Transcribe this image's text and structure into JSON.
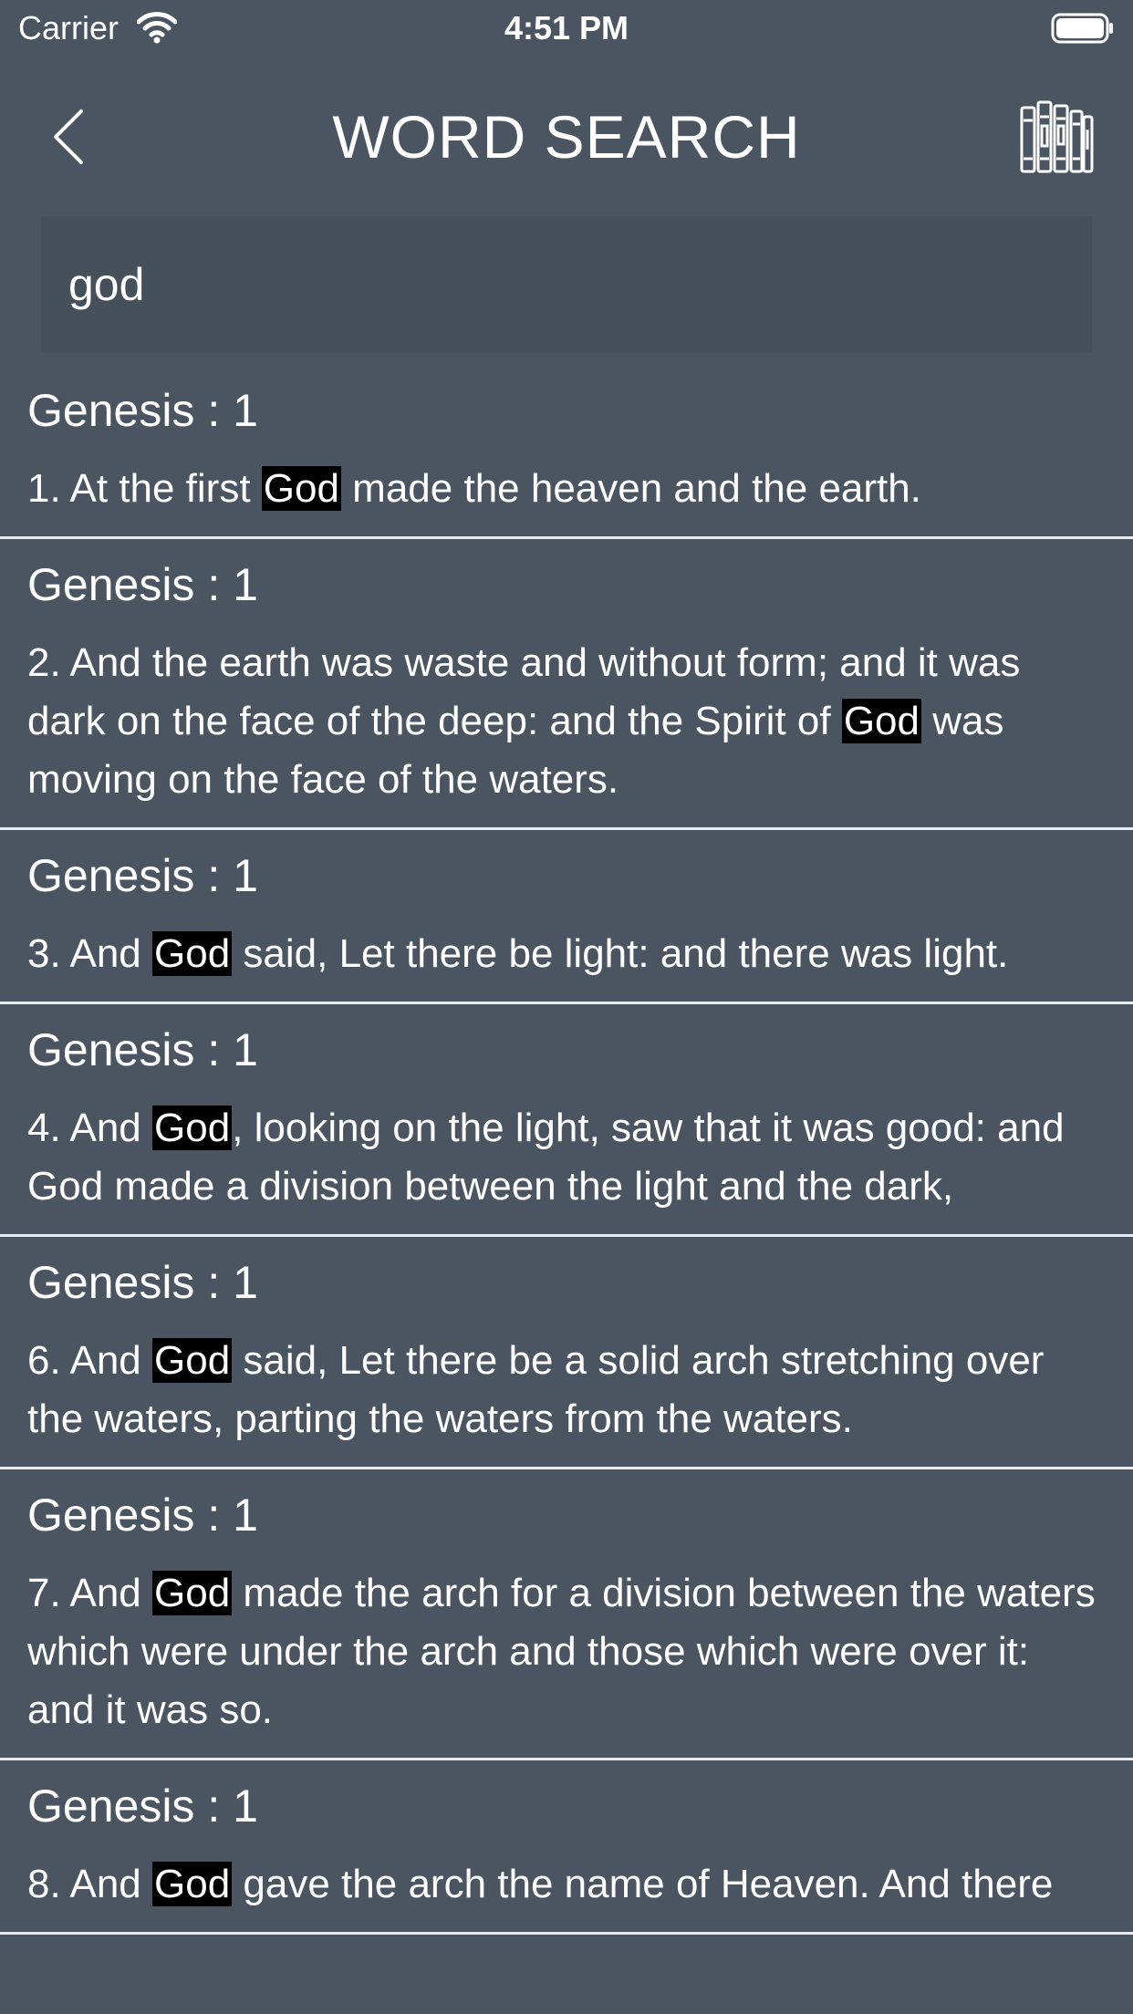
{
  "status_bar": {
    "carrier": "Carrier",
    "time": "4:51 PM"
  },
  "header": {
    "title": "WORD SEARCH",
    "back_icon": "chevron-left-icon",
    "library_icon": "bookshelf-icon"
  },
  "search": {
    "value": "god",
    "placeholder": ""
  },
  "colors": {
    "background": "#4b5561",
    "search_field": "#46505b",
    "highlight": "#000000",
    "text": "#ffffff",
    "divider": "#e8ebee"
  },
  "results": [
    {
      "reference": "Genesis : 1",
      "before": "1. At the first ",
      "match": "God",
      "after": " made the heaven and the earth."
    },
    {
      "reference": "Genesis : 1",
      "before": "2. And the earth was waste and without form; and it was dark on the face of the deep: and the Spirit of ",
      "match": "God",
      "after": " was moving on the face of the waters."
    },
    {
      "reference": "Genesis : 1",
      "before": "3. And ",
      "match": "God",
      "after": " said, Let there be light: and there was light."
    },
    {
      "reference": "Genesis : 1",
      "before": "4. And ",
      "match": "God",
      "after": ", looking on the light, saw that it was good: and God made a division between the light and the dark,"
    },
    {
      "reference": "Genesis : 1",
      "before": "6. And ",
      "match": "God",
      "after": " said, Let there be a solid arch stretching over the waters, parting the waters from the waters."
    },
    {
      "reference": "Genesis : 1",
      "before": "7. And ",
      "match": "God",
      "after": " made the arch for a division between the waters which were under the arch and those which were over it: and it was so."
    },
    {
      "reference": "Genesis : 1",
      "before": "8. And ",
      "match": "God",
      "after": " gave the arch the name of Heaven. And there"
    }
  ]
}
